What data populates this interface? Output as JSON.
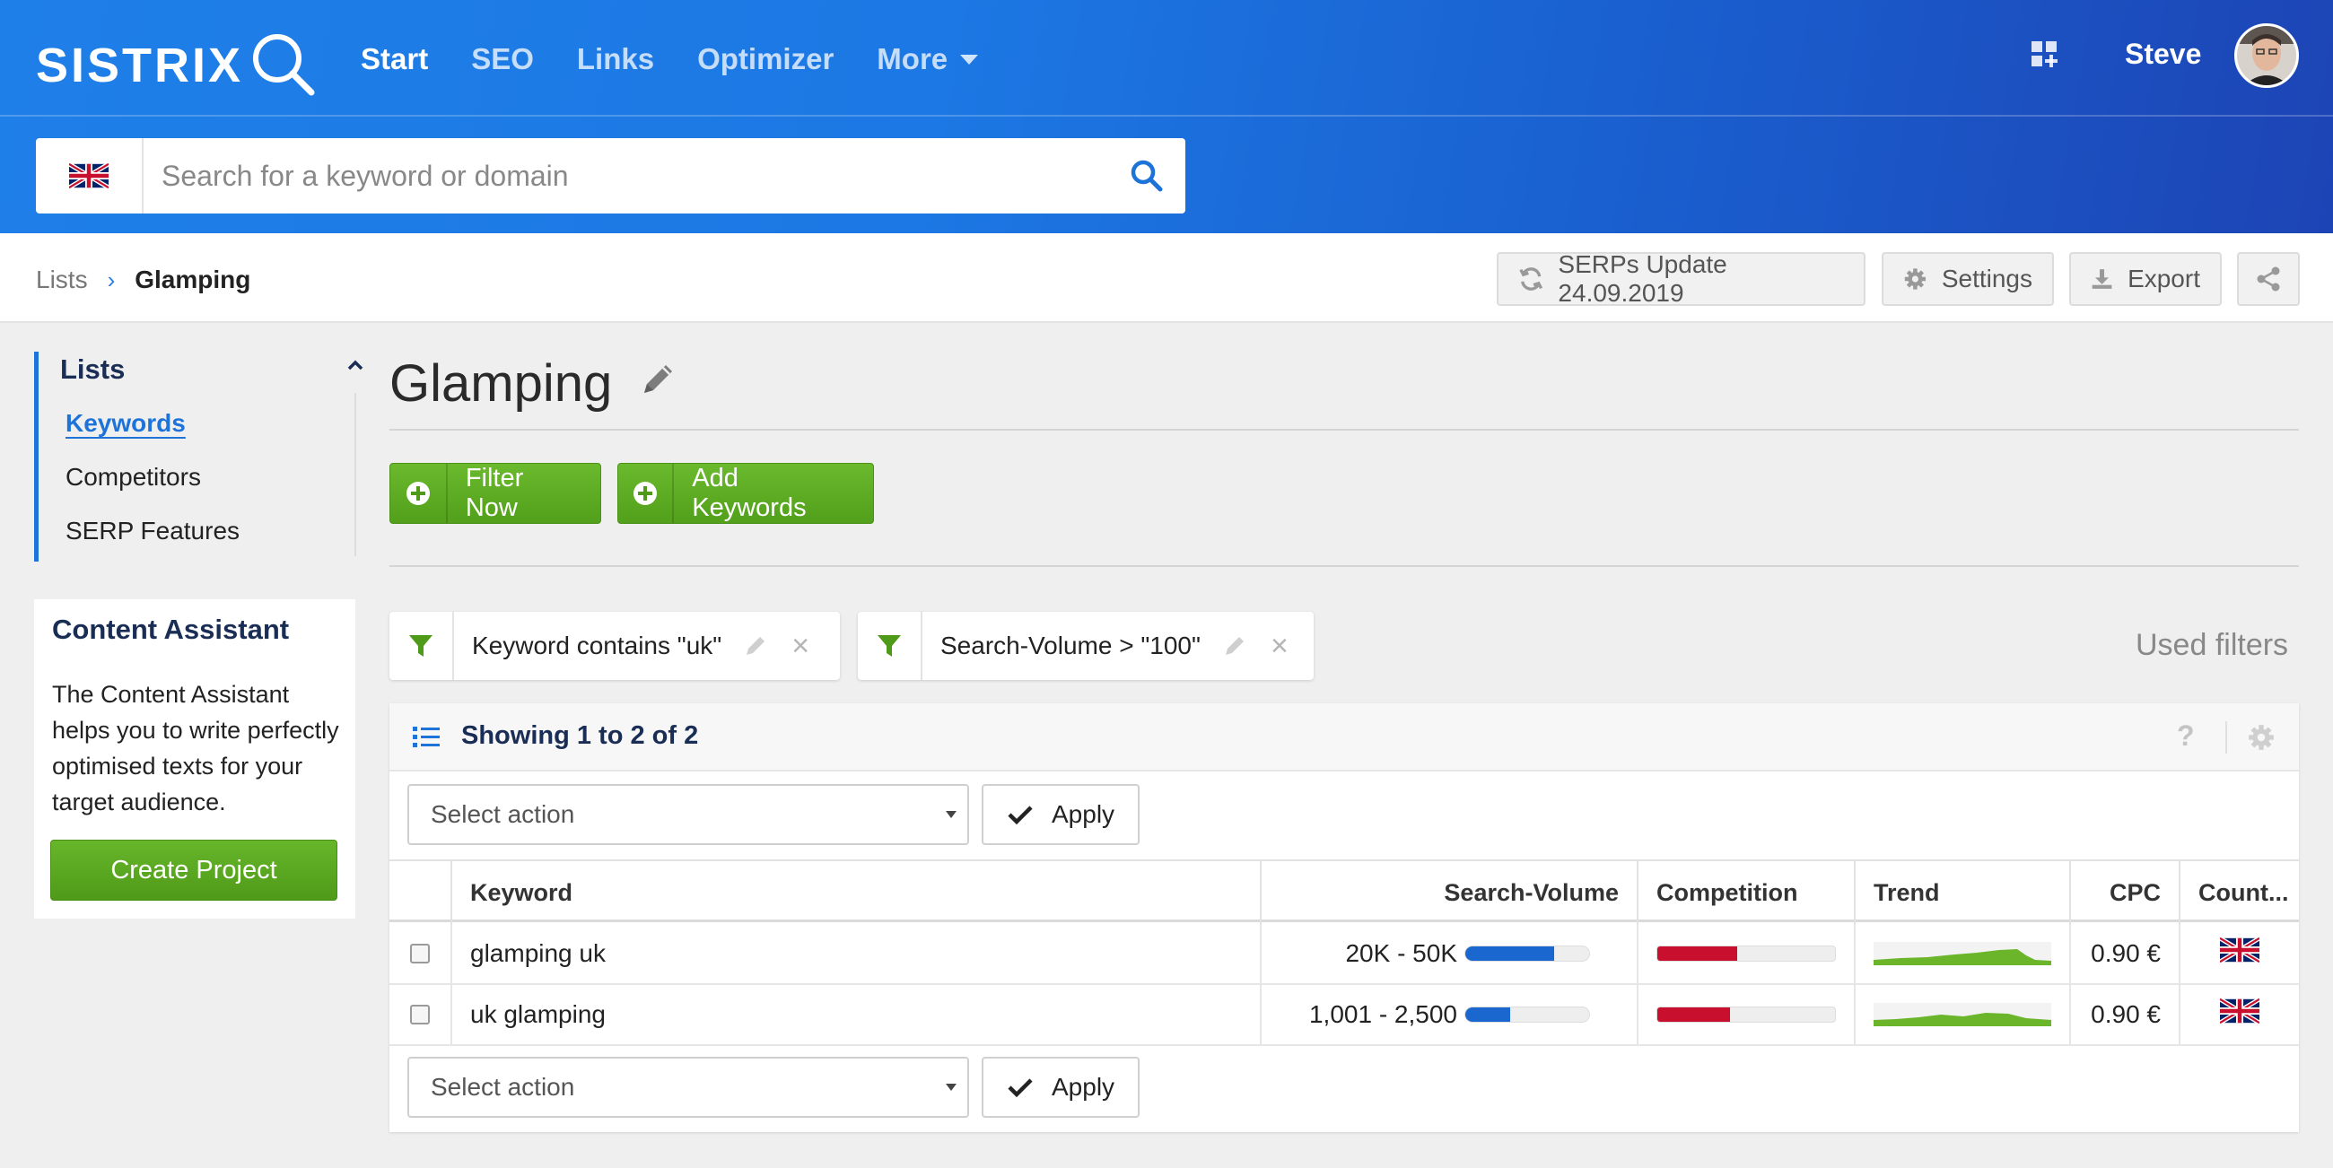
{
  "header": {
    "logo": "SISTRIX",
    "nav": [
      {
        "label": "Start",
        "active": true
      },
      {
        "label": "SEO",
        "active": false
      },
      {
        "label": "Links",
        "active": false
      },
      {
        "label": "Optimizer",
        "active": false
      },
      {
        "label": "More",
        "active": false
      }
    ],
    "user_name": "Steve",
    "icons": {
      "apps": "apps-grid-icon",
      "avatar": "user-avatar"
    }
  },
  "search": {
    "placeholder": "Search for a keyword or domain",
    "value": "",
    "country_flag": "uk-flag-icon"
  },
  "breadcrumb": {
    "parent": "Lists",
    "current": "Glamping"
  },
  "toolbar": {
    "serps_update": "SERPs Update 24.09.2019",
    "settings": "Settings",
    "export": "Export",
    "share_icon": "share-icon"
  },
  "sidebar": {
    "title": "Lists",
    "items": [
      {
        "label": "Keywords",
        "active": true
      },
      {
        "label": "Competitors",
        "active": false
      },
      {
        "label": "SERP Features",
        "active": false
      }
    ]
  },
  "content_assistant": {
    "title": "Content Assistant",
    "text": "The Content Assistant helps you to write perfectly optimised texts for your target audience.",
    "button": "Create Project"
  },
  "main": {
    "title": "Glamping",
    "buttons": {
      "filter_now": "Filter Now",
      "add_keywords": "Add Keywords"
    },
    "filters": [
      {
        "label": "Keyword contains \"uk\""
      },
      {
        "label": "Search-Volume > \"100\""
      }
    ],
    "used_filters_label": "Used filters"
  },
  "table_panel": {
    "showing": "Showing 1 to 2 of 2",
    "help": "?",
    "select_action_placeholder": "Select action",
    "apply": "Apply",
    "columns": [
      "Keyword",
      "Search-Volume",
      "Competition",
      "Trend",
      "CPC",
      "Count..."
    ],
    "rows": [
      {
        "keyword": "glamping uk",
        "volume": "20K - 50K",
        "volume_level": 0.72,
        "competition_level": 0.45,
        "cpc": "0.90 €",
        "country": "uk-flag-icon"
      },
      {
        "keyword": "uk glamping",
        "volume": "1,001 - 2,500",
        "volume_level": 0.36,
        "competition_level": 0.41,
        "cpc": "0.90 €",
        "country": "uk-flag-icon"
      }
    ]
  },
  "colors": {
    "header_blue": "#1f7fe8",
    "green_button": "#5aa820",
    "volume_bar": "#1b67d0",
    "competition_bar": "#c8102e",
    "trend": "#6bb52a",
    "title_navy": "#1a2d55"
  }
}
